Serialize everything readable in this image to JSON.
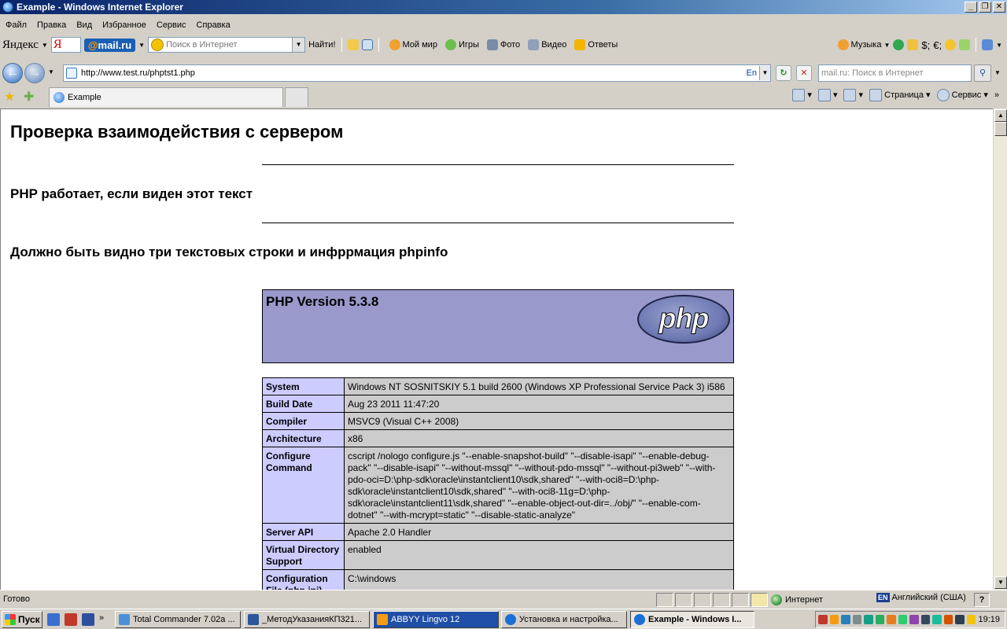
{
  "window": {
    "title": "Example - Windows Internet Explorer"
  },
  "menu": [
    "Файл",
    "Правка",
    "Вид",
    "Избранное",
    "Сервис",
    "Справка"
  ],
  "toolbar": {
    "yandex_label": "Яндекс",
    "ya_box": "Я",
    "mailru": "mail.ru",
    "search_placeholder": "Поиск в Интернет",
    "find_label": "Найти!",
    "my_world": "Мой мир",
    "games": "Игры",
    "photo": "Фото",
    "video": "Видео",
    "answers": "Ответы",
    "music": "Музыка"
  },
  "address": {
    "url": "http://www.test.ru/phptst1.php",
    "lang": "En",
    "search_placeholder": "mail.ru: Поиск в Интернет"
  },
  "tabs": [
    {
      "label": "Example"
    }
  ],
  "commands": {
    "page": "Страница",
    "service": "Сервис"
  },
  "page": {
    "heading": "Проверка взаимодействия с сервером",
    "line1": "PHP работает, если виден этот текст",
    "line2": "Должно быть видно три текстовых строки и инфррмация phpinfo",
    "php_version": "PHP Version 5.3.8",
    "php_logo": "php"
  },
  "phpinfo": [
    {
      "key": "System",
      "value": "Windows NT SOSNITSKIY 5.1 build 2600 (Windows XP Professional Service Pack 3) i586"
    },
    {
      "key": "Build Date",
      "value": "Aug 23 2011 11:47:20"
    },
    {
      "key": "Compiler",
      "value": "MSVC9 (Visual C++ 2008)"
    },
    {
      "key": "Architecture",
      "value": "x86"
    },
    {
      "key": "Configure Command",
      "value": "cscript /nologo configure.js \"--enable-snapshot-build\" \"--disable-isapi\" \"--enable-debug-pack\" \"--disable-isapi\" \"--without-mssql\" \"--without-pdo-mssql\" \"--without-pi3web\" \"--with-pdo-oci=D:\\php-sdk\\oracle\\instantclient10\\sdk,shared\" \"--with-oci8=D:\\php-sdk\\oracle\\instantclient10\\sdk,shared\" \"--with-oci8-11g=D:\\php-sdk\\oracle\\instantclient11\\sdk,shared\" \"--enable-object-out-dir=../obj/\" \"--enable-com-dotnet\" \"--with-mcrypt=static\" \"--disable-static-analyze\""
    },
    {
      "key": "Server API",
      "value": "Apache 2.0 Handler"
    },
    {
      "key": "Virtual Directory Support",
      "value": "enabled"
    },
    {
      "key": "Configuration File (php.ini) Path",
      "value": "C:\\windows"
    }
  ],
  "status": {
    "text": "Готово",
    "zone": "Интернет",
    "lang_badge": "EN",
    "lang": "Английский (США)"
  },
  "taskbar": {
    "start": "Пуск",
    "tasks": [
      "Total Commander 7.02a ...",
      "_МетодУказанияКП321...",
      "ABBYY Lingvo 12",
      "Установка и настройка...",
      "Example - Windows I..."
    ],
    "clock": "19:19"
  }
}
